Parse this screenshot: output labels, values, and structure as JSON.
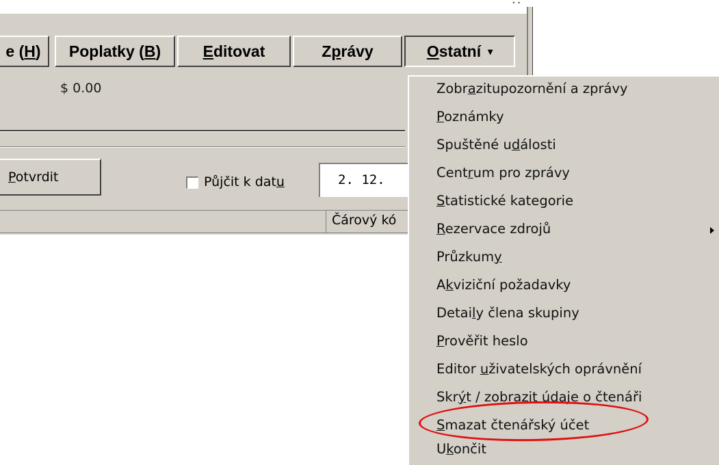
{
  "tabs": {
    "partial": {
      "pre": "e (",
      "key": "H",
      "post": ")"
    },
    "fees": {
      "pre": "Poplatky (",
      "key": "B",
      "post": ")"
    },
    "edit": {
      "pre": "",
      "key": "E",
      "post": "ditovat"
    },
    "messages": {
      "pre": "Z",
      "key": "p",
      "post": "rávy"
    },
    "other": {
      "pre": "",
      "key": "O",
      "post": "statní",
      "arrow": "▾"
    }
  },
  "fee_value": "$ 0.00",
  "confirm_button": {
    "pre": "",
    "key": "P",
    "post": "otvrdit"
  },
  "lend_date": {
    "pre": "Půjčit k dat",
    "key": "u",
    "post": ""
  },
  "date_value": "2. 12.",
  "status_cell": "Čárový kó",
  "menu": {
    "items": [
      {
        "pre": "Zobr",
        "key": "a",
        "post": "zitupozornění a zprávy"
      },
      {
        "pre": "",
        "key": "P",
        "post": "oznámky"
      },
      {
        "pre": "Spuštěné u",
        "key": "d",
        "post": "álosti"
      },
      {
        "pre": "Cent",
        "key": "r",
        "post": "um pro zprávy"
      },
      {
        "pre": "",
        "key": "S",
        "post": "tatistické kategorie"
      },
      {
        "pre": "",
        "key": "R",
        "post": "ezervace zdrojů",
        "submenu": true
      },
      {
        "pre": "Průzkum",
        "key": "y",
        "post": ""
      },
      {
        "pre": "A",
        "key": "k",
        "post": "viziční požadavky"
      },
      {
        "pre": "Detai",
        "key": "l",
        "post": "y člena skupiny"
      },
      {
        "pre": "",
        "key": "P",
        "post": "rověřit heslo"
      },
      {
        "pre": "Editor ",
        "key": "u",
        "post": "živatelských oprávnění"
      },
      {
        "pre": "Skr",
        "key": "ý",
        "post": "t / zobrazit údaje o čtenáři"
      },
      {
        "pre": "",
        "key": "S",
        "post": "mazat čtenářský  účet"
      },
      {
        "pre": "U",
        "key": "k",
        "post": "ončit"
      }
    ]
  },
  "highlight_color": "#e01010"
}
